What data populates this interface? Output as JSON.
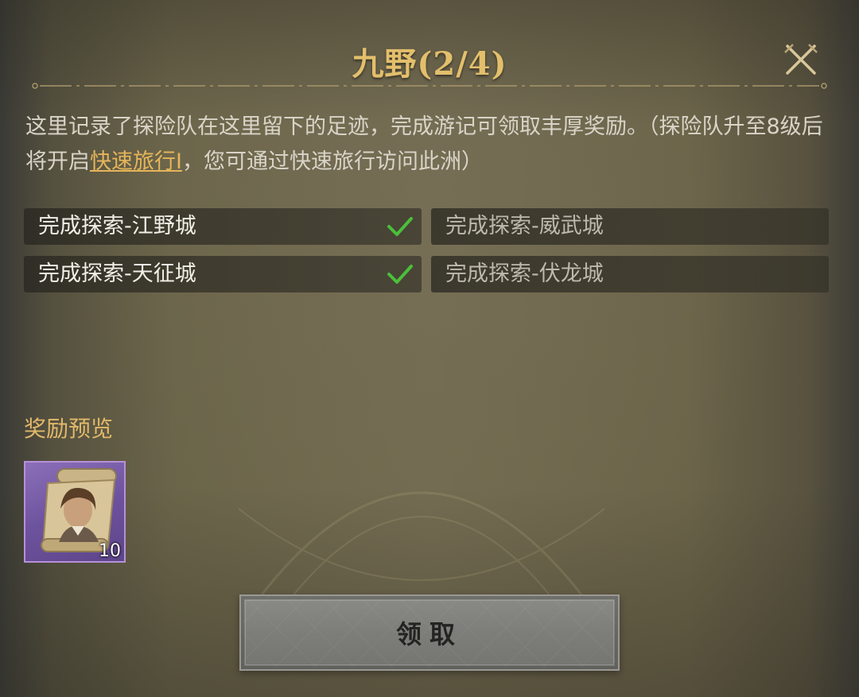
{
  "header": {
    "title": "九野(2/4)",
    "close_icon": "close-crossed-swords-icon"
  },
  "description": {
    "text_before": "这里记录了探险队在这里留下的足迹，完成游记可领取丰厚奖励。（探险队升至8级后将开启",
    "link_text": "快速旅行I",
    "text_after": "，您可通过快速旅行访问此洲）"
  },
  "tasks": [
    {
      "label": "完成探索-江野城",
      "completed": true
    },
    {
      "label": "完成探索-威武城",
      "completed": false
    },
    {
      "label": "完成探索-天征城",
      "completed": true
    },
    {
      "label": "完成探索-伏龙城",
      "completed": false
    }
  ],
  "rewards": {
    "section_label": "奖励预览",
    "items": [
      {
        "icon": "hero-portrait-scroll-icon",
        "count": "10",
        "rarity_color": "#7a5fae"
      }
    ]
  },
  "claim_button": {
    "label": "领取",
    "state": "disabled"
  },
  "colors": {
    "title": "#e3bf6c",
    "link": "#e6b55a",
    "check": "#4bbf3a",
    "section_label": "#e2b86a"
  }
}
